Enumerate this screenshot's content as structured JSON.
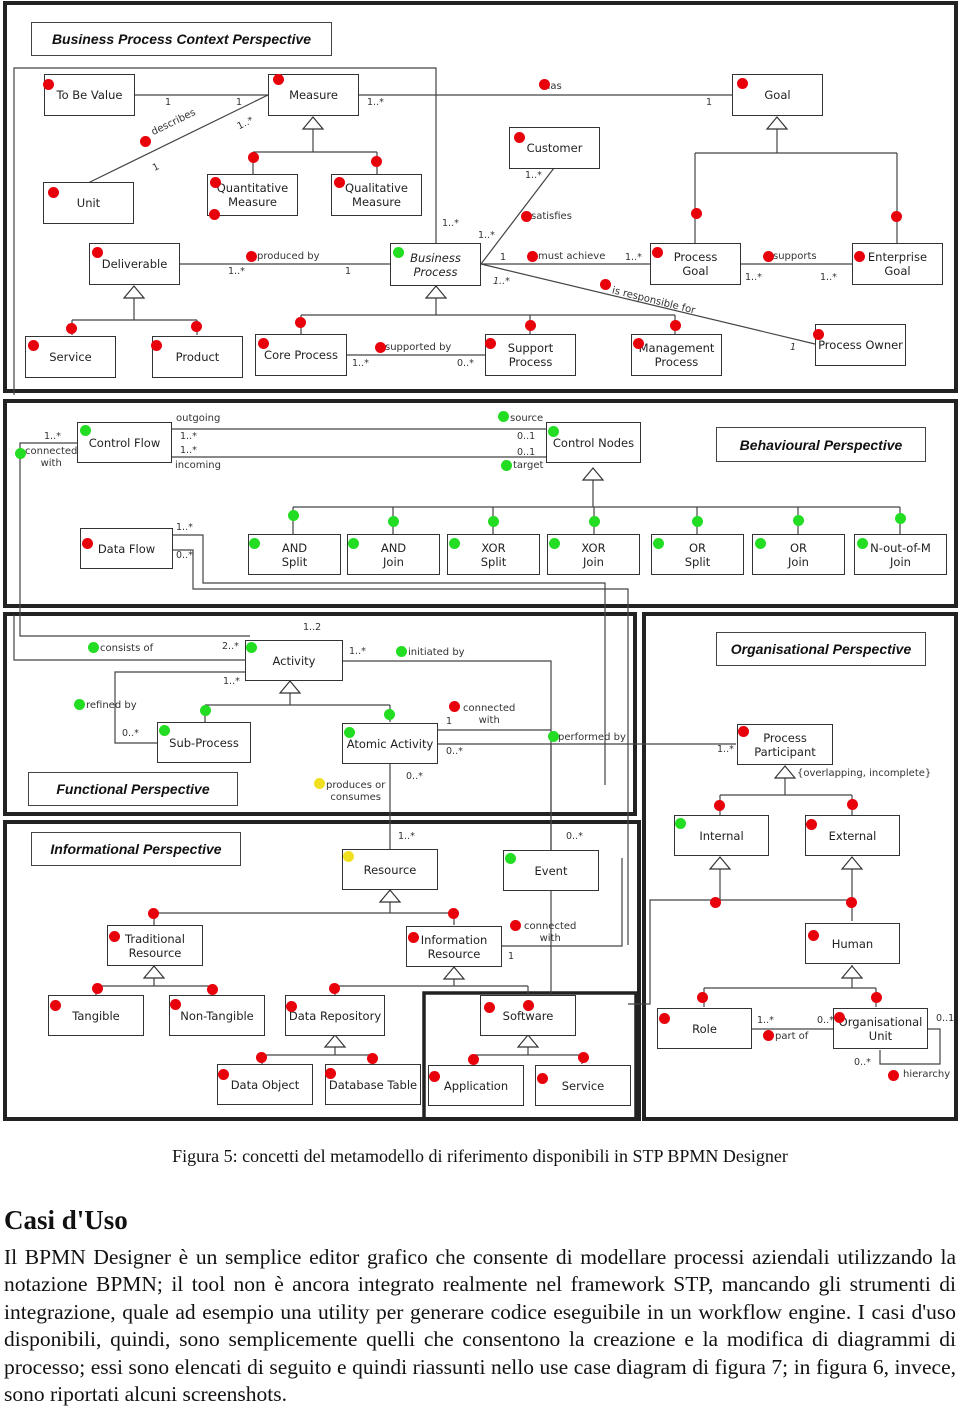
{
  "perspectives": {
    "business": "Business Process Context  Perspective",
    "behavioural": "Behavioural Perspective",
    "functional": "Functional Perspective",
    "organisational": "Organisational Perspective",
    "informational": "Informational Perspective"
  },
  "classes": {
    "to_be_value": "To Be Value",
    "measure": "Measure",
    "goal": "Goal",
    "customer": "Customer",
    "unit": "Unit",
    "quantitative_measure": "Quantitative\nMeasure",
    "qualitative_measure": "Qualitative\nMeasure",
    "deliverable": "Deliverable",
    "business_process": "Business\nProcess",
    "process_goal": "Process\nGoal",
    "enterprise_goal": "Enterprise\nGoal",
    "service": "Service",
    "product": "Product",
    "core_process": "Core Process",
    "support_process": "Support Process",
    "management_process": "Management\nProcess",
    "process_owner": "Process Owner",
    "control_flow": "Control Flow",
    "control_nodes": "Control Nodes",
    "data_flow": "Data Flow",
    "and_split": "AND\nSplit",
    "and_join": "AND\nJoin",
    "xor_split": "XOR\nSplit",
    "xor_join": "XOR\nJoin",
    "or_split": "OR\nSplit",
    "or_join": "OR\nJoin",
    "n_out_of_m_join": "N-out-of-M\nJoin",
    "activity": "Activity",
    "sub_process": "Sub-Process",
    "atomic_activity": "Atomic Activity",
    "process_participant": "Process\nParticipant",
    "internal": "Internal",
    "external": "External",
    "resource": "Resource",
    "event": "Event",
    "traditional_resource": "Traditional\nResource",
    "information_resource": "Information\nResource",
    "human": "Human",
    "tangible": "Tangible",
    "non_tangible": "Non-Tangible",
    "data_repository": "Data Repository",
    "software": "Software",
    "role": "Role",
    "organisational_unit": "Organisational\nUnit",
    "data_object": "Data Object",
    "database_table": "Database Table",
    "application": "Application",
    "service_sw": "Service"
  },
  "associations": {
    "describes": "describes",
    "has": "has",
    "satisfies": "satisfies",
    "produced_by": "produced by",
    "must_achieve": "must  achieve",
    "supports": "supports",
    "is_responsible_for": "is responsible for",
    "supported_by": "supported by",
    "outgoing": "outgoing",
    "incoming": "incoming",
    "source": "source",
    "target": "target",
    "connected_with": "connected\nwith",
    "consists_of": "consists of",
    "initiated_by": "initiated by",
    "refined_by": "refined by",
    "connected_with_2": "connected\nwith",
    "performed_by": "performed by",
    "produces_or_consumes": "produces or\nconsumes",
    "overlapping": "{overlapping, incomplete}",
    "connected_with_3": "connected\nwith",
    "part_of": "part of",
    "hierarchy": "hierarchy"
  },
  "multiplicities": {
    "one": "1",
    "one_many": "1..*",
    "zero_many": "0..*",
    "zero_one": "0..1",
    "two_many": "2..*",
    "one_two": "1..2"
  },
  "legend_colors": {
    "red": "#e8000b",
    "green": "#22dd22",
    "yellow": "#f0e020"
  },
  "caption": "Figura 5: concetti del metamodello di riferimento disponibili in STP BPMN Designer",
  "section_title": "Casi d'Uso",
  "paragraph": "Il BPMN Designer è un semplice editor grafico che consente di modellare processi aziendali utilizzando la notazione BPMN; il tool non è ancora integrato realmente nel framework STP, mancando gli strumenti di integrazione, quale ad esempio una utility per generare codice eseguibile in un workflow engine. I casi d'uso disponibili, quindi, sono semplicemente quelli che consentono la creazione e la modifica di diagrammi di processo; essi sono elencati di seguito e quindi riassunti nello use case diagram di figura 7; in figura 6, invece, sono riportati alcuni screenshots."
}
